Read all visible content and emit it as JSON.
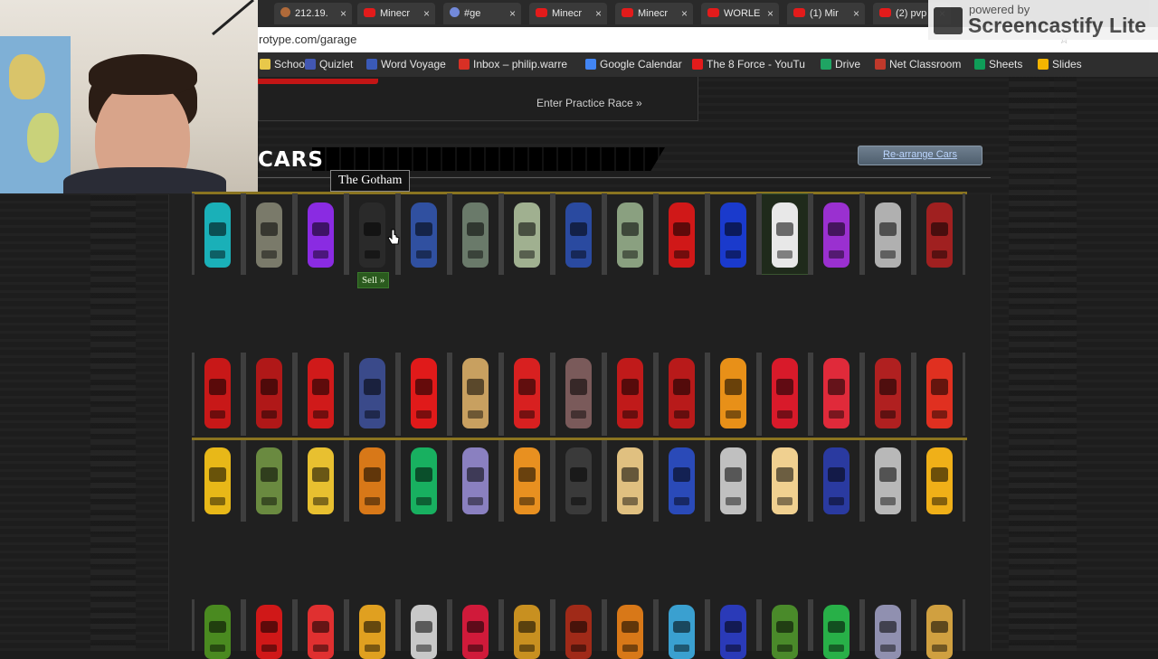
{
  "browser": {
    "tabs": [
      {
        "label": "212.19.",
        "icon": "server-icon"
      },
      {
        "label": "Minecr",
        "icon": "youtube-icon"
      },
      {
        "label": "#ge",
        "icon": "discord-icon"
      },
      {
        "label": "Minecr",
        "icon": "youtube-icon"
      },
      {
        "label": "Minecr",
        "icon": "youtube-icon"
      },
      {
        "label": "WORLE",
        "icon": "youtube-icon"
      },
      {
        "label": "(1) Mir",
        "icon": "youtube-icon"
      },
      {
        "label": "(2) pvp",
        "icon": "youtube-icon"
      }
    ],
    "url": "rotype.com/garage",
    "bookmarks": [
      {
        "label": "School",
        "icon": "folder-icon"
      },
      {
        "label": "Quizlet",
        "icon": "quizlet-icon"
      },
      {
        "label": "Word Voyage",
        "icon": "wordvoyage-icon"
      },
      {
        "label": "Inbox – philip.warre",
        "icon": "gmail-icon"
      },
      {
        "label": "Google Calendar",
        "icon": "calendar-icon"
      },
      {
        "label": "The 8 Force - YouTu",
        "icon": "youtube-icon"
      },
      {
        "label": "Drive",
        "icon": "drive-icon"
      },
      {
        "label": "Net Classroom",
        "icon": "netclassroom-icon"
      },
      {
        "label": "Sheets",
        "icon": "sheets-icon"
      },
      {
        "label": "Slides",
        "icon": "slides-icon"
      }
    ]
  },
  "overlay": {
    "powered_by": "powered by",
    "brand": "Screencastify Lite"
  },
  "garage": {
    "practice_link": "Enter Practice Race »",
    "heading": "CARS",
    "rearrange_label": "Re-arrange Cars",
    "tooltip": "The Gotham",
    "sell_label": "Sell »",
    "rows": [
      [
        "#1ab0b8",
        "#7a7a6a",
        "#8a2be2",
        "#2a2a2a",
        "#3050a0",
        "#6a7a6a",
        "#a0b090",
        "#2a4aa0",
        "#8aa080",
        "#d01818",
        "#1a3acc",
        "#e8e8e8",
        "#9a30d0",
        "#b0b0b0",
        "#a02020"
      ],
      [
        "#c81818",
        "#b01818",
        "#d01a1a",
        "#3a4a8a",
        "#e01a1a",
        "#c8a060",
        "#d82020",
        "#7a5a5a",
        "#c01a1a",
        "#b81a1a",
        "#e89018",
        "#d81a2a",
        "#e02a3a",
        "#b02020",
        "#e03020"
      ],
      [
        "#e8b818",
        "#6a8a40",
        "#e8c030",
        "#d87818",
        "#18b060",
        "#8a80c0",
        "#e89020",
        "#3a3a3a",
        "#e0c080",
        "#2a4ab8",
        "#c0c0c0",
        "#f0d090",
        "#2a3aa0",
        "#b8b8b8",
        "#f0b018"
      ],
      [
        "#4a8a20",
        "#d01818",
        "#e03030",
        "#e0a020",
        "#c8c8c8",
        "#d01a3a",
        "#c89020",
        "#a02a18",
        "#d87818",
        "#3aa0d0",
        "#2a3ab8",
        "#4a8a2a",
        "#28b048",
        "#9090b0",
        "#d0a040"
      ]
    ]
  }
}
